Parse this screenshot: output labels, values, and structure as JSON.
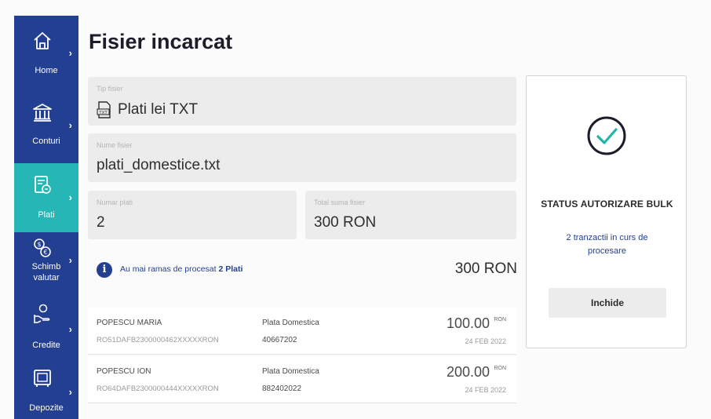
{
  "sidebar": {
    "items": [
      {
        "label": "Home",
        "icon": "home-icon"
      },
      {
        "label": "Conturi",
        "icon": "bank-icon"
      },
      {
        "label": "Plati",
        "icon": "payments-icon"
      },
      {
        "label": "Schimb valutar",
        "label_line1": "Schimb",
        "label_line2": "valutar",
        "icon": "currency-exchange-icon"
      },
      {
        "label": "Credite",
        "icon": "credit-icon"
      },
      {
        "label": "Depozite",
        "icon": "deposit-icon"
      }
    ],
    "active": "Plati",
    "chevron": "›"
  },
  "page": {
    "title": "Fisier incarcat"
  },
  "fields": {
    "file_type": {
      "label": "Tip fisier",
      "value": "Plati lei TXT",
      "icon": "txt-file-icon"
    },
    "file_name": {
      "label": "Nume fisier",
      "value": "plati_domestice.txt"
    },
    "payment_count": {
      "label": "Numar plati",
      "value": "2"
    },
    "total_amount": {
      "label": "Total suma fisier",
      "value": "300 RON"
    }
  },
  "info": {
    "icon": "info-icon",
    "text_prefix": "Au mai ramas de procesat",
    "text_count": "2 Plati",
    "total": "300 RON"
  },
  "transactions": [
    {
      "name": "POPESCU MARIA",
      "iban": "RO51DAFB2300000462XXXXXRON",
      "type": "Plata Domestica",
      "reference": "40667202",
      "amount": "100.00",
      "currency": "RON",
      "date": "24 FEB 2022"
    },
    {
      "name": "POPESCU ION",
      "iban": "RO64DAFB2300000444XXXXXRON",
      "type": "Plata Domestica",
      "reference": "882402022",
      "amount": "200.00",
      "currency": "RON",
      "date": "24 FEB 2022"
    }
  ],
  "status_card": {
    "icon": "check-circle-icon",
    "title": "STATUS AUTORIZARE BULK",
    "description": "2 tranzactii in curs de procesare",
    "button_label": "Inchide"
  },
  "colors": {
    "sidebar_bg": "#233f92",
    "active_item": "#27b6b6",
    "accent_blue": "#233f92",
    "check_teal": "#21b5a9",
    "field_bg": "#ececec"
  }
}
